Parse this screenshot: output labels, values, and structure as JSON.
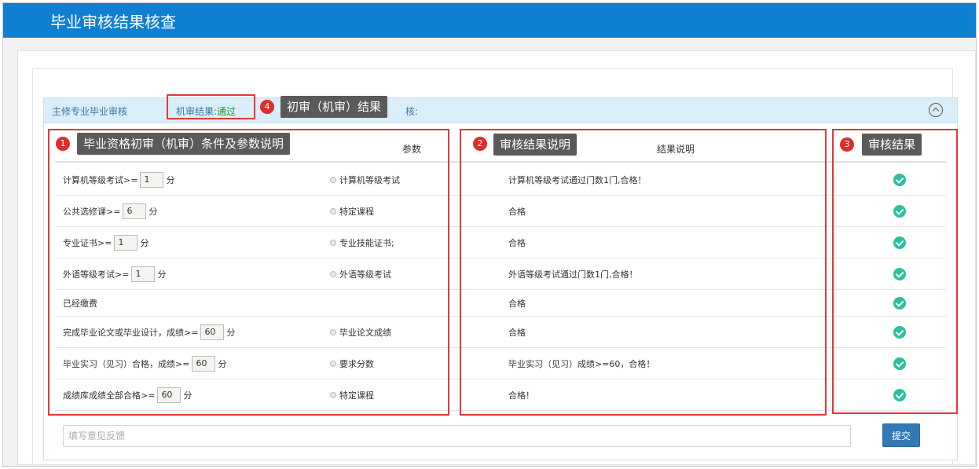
{
  "header": {
    "title": "毕业审核结果核查"
  },
  "panel": {
    "title": "主修专业毕业审核",
    "machine_label": "机审结果:",
    "machine_value": "通过",
    "hidden_label": "核:"
  },
  "table": {
    "headers": {
      "params": "参数",
      "result_desc": "结果说明"
    },
    "rows": [
      {
        "cond_prefix": "计算机等级考试>=",
        "value": "1",
        "unit": "分",
        "param": "计算机等级考试",
        "result": "计算机等级考试通过门数1门,合格！"
      },
      {
        "cond_prefix": "公共选修课>=",
        "value": "6",
        "unit": "分",
        "param": "特定课程",
        "result": "合格"
      },
      {
        "cond_prefix": "专业证书>=",
        "value": "1",
        "unit": "分",
        "param": "专业技能证书;",
        "result": "合格"
      },
      {
        "cond_prefix": "外语等级考试>=",
        "value": "1",
        "unit": "分",
        "param": "外语等级考试",
        "result": "外语等级考试通过门数1门,合格！"
      },
      {
        "cond_prefix": "已经缴费",
        "value": "",
        "unit": "",
        "param": "",
        "result": "合格"
      },
      {
        "cond_prefix": "完成毕业论文或毕业设计，成绩>=",
        "value": "60",
        "unit": "分",
        "param": "毕业论文成绩",
        "result": "合格"
      },
      {
        "cond_prefix": "毕业实习（见习）合格，成绩>=",
        "value": "60",
        "unit": "分",
        "param": "要求分数",
        "result": "毕业实习（见习）成绩>=60，合格！"
      },
      {
        "cond_prefix": "成绩库成绩全部合格>=",
        "value": "60",
        "unit": "分",
        "param": "特定课程",
        "result": "合格！"
      }
    ]
  },
  "feedback": {
    "placeholder": "填写意见反馈"
  },
  "submit_label": "提交",
  "annotations": {
    "a1": {
      "num": "1",
      "text": "毕业资格初审（机审）条件及参数说明"
    },
    "a2": {
      "num": "2",
      "text": "审核结果说明"
    },
    "a3": {
      "num": "3",
      "text": "审核结果"
    },
    "a4": {
      "num": "4",
      "text": "初审（机审）结果"
    }
  },
  "colors": {
    "header_bg": "#0f7fd1",
    "annotation_red": "#e43838",
    "check_green": "#2cc0a0",
    "pass_green": "#1f9d1f",
    "submit_blue": "#3479b7"
  }
}
